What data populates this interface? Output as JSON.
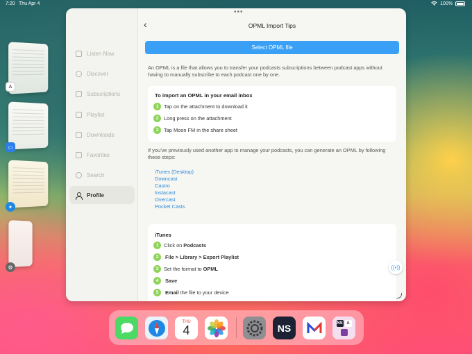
{
  "status_bar": {
    "time": "7:20",
    "date": "Thu Apr 4",
    "battery": "100%"
  },
  "side_apps": [
    {
      "icon": "font-app-icon",
      "label": "A"
    }
  ],
  "sidebar": {
    "items": [
      {
        "label": "Listen Now"
      },
      {
        "label": "Discover"
      },
      {
        "label": "Subscriptions"
      },
      {
        "label": "Playlist"
      },
      {
        "label": "Downloads"
      },
      {
        "label": "Favorites"
      },
      {
        "label": "Search"
      },
      {
        "label": "Profile"
      }
    ]
  },
  "header": {
    "title": "OPML Import Tips",
    "back_glyph": "‹"
  },
  "select_button": "Select OPML file",
  "intro": "An OPML is a file that allows you to transfer your podcasts subscriptions between podcast apps without having to manually subscribe to each podcast one by one.",
  "email_card": {
    "title": "To import an OPML in your email inbox",
    "steps": [
      {
        "n": "1",
        "text": "Tap on the attachment to download it"
      },
      {
        "n": "2",
        "text": "Long press on the attachment"
      },
      {
        "n": "3",
        "text": "Tap Moon FM in the share sheet"
      }
    ]
  },
  "other_apps_text": "If you’ve previously used another app to manage your podcasts, you can generate an OPML by following these steps:",
  "apps": [
    "iTunes (Desktop)",
    "Downcast",
    "Castro",
    "Instacast",
    "Overcast",
    "Pocket Casts"
  ],
  "itunes_card": {
    "title": "iTunes",
    "steps": [
      {
        "n": "1",
        "pre": "Click on",
        "bold": "Podcasts",
        "post": ""
      },
      {
        "n": "2",
        "pre": "",
        "bold": "File > Library > Export Playlist",
        "post": ""
      },
      {
        "n": "3",
        "pre": "Set the format to",
        "bold": "OPML",
        "post": ""
      },
      {
        "n": "4",
        "pre": "",
        "bold": "Save",
        "post": ""
      },
      {
        "n": "5",
        "pre": "",
        "bold": "Email",
        "post": "the file to your device"
      }
    ]
  },
  "dock": {
    "calendar_day": "THU",
    "calendar_date": "4",
    "ns_label": "NS",
    "mini_ns": "NS",
    "mini_a": "A"
  },
  "colors": {
    "accent": "#3aa0f5",
    "step_green": "#8fd45a",
    "link": "#2e8bd8"
  }
}
